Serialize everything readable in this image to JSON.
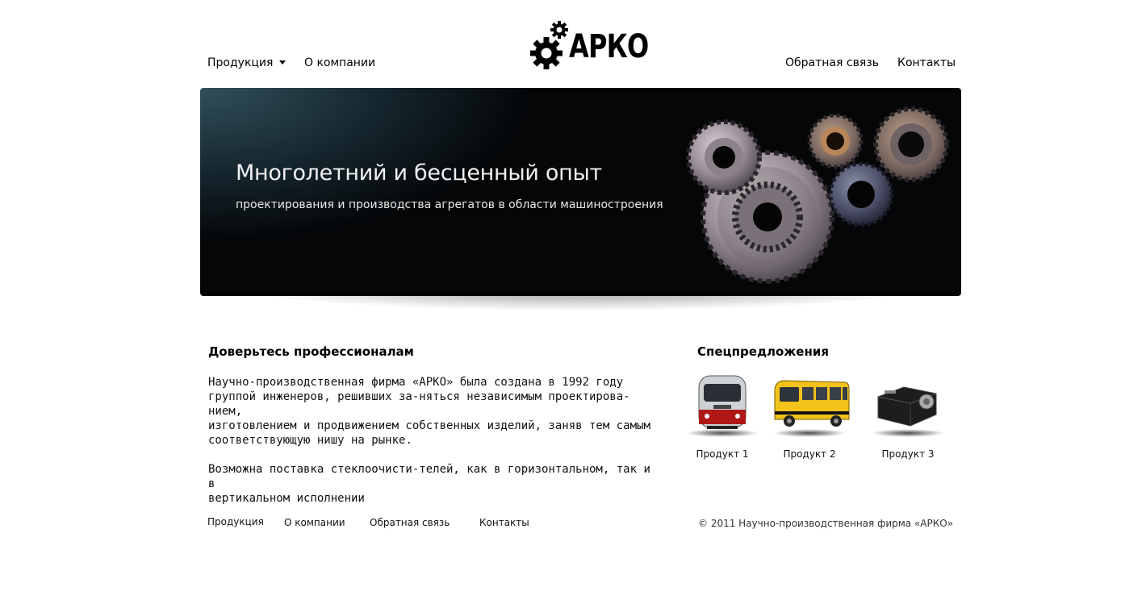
{
  "header": {
    "nav_left": [
      {
        "label": "Продукция",
        "has_dropdown": true
      },
      {
        "label": "О компании"
      }
    ],
    "logo_text": "АРКО",
    "nav_right": [
      {
        "label": "Обратная связь"
      },
      {
        "label": "Контакты"
      }
    ]
  },
  "banner": {
    "title": "Многолетний и бесценный опыт",
    "subtitle": "проектирования и производства агрегатов в области машиностроения"
  },
  "about": {
    "heading": "Доверьтесь профессионалам",
    "paragraph1_lines": [
      "Научно-производственная фирма «АРКО» была создана в 1992 году",
      "группой инженеров, решивших за-няться независимым проектирова-нием,",
      "изготовлением и продвижением собственных изделий, заняв тем самым",
      "соответствующую нишу на рынке."
    ],
    "paragraph2_lines": [
      "Возможна поставка стеклоочисти-телей, как в горизонтальном, так и в",
      "вертикальном исполнении"
    ]
  },
  "offers": {
    "heading": "Спецпредложения",
    "products": [
      {
        "label": "Продукт 1",
        "icon": "train-icon"
      },
      {
        "label": "Продукт 2",
        "icon": "bus-icon"
      },
      {
        "label": "Продукт 3",
        "icon": "device-icon"
      }
    ]
  },
  "footer": {
    "links": [
      "Продукция",
      "О компании",
      "Обратная связь",
      "Контакты"
    ],
    "copyright": "© 2011 Научно-производственная фирма «АРКО»"
  },
  "colors": {
    "bus_yellow": "#f2c21a",
    "train_red": "#b01818",
    "banner_dark": "#040608"
  }
}
